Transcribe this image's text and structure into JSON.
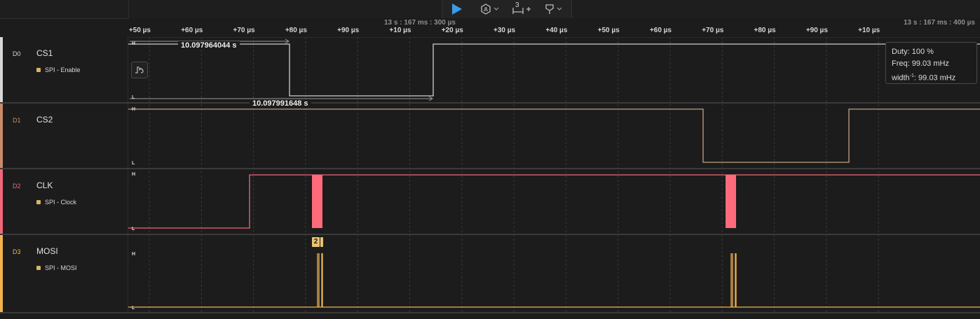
{
  "toolbar": {
    "play_icon": "play-icon",
    "trigger_icon": "trigger-icon",
    "measure_count": "3",
    "measure_icon": "measure-add-icon",
    "marker_icon": "marker-pin-icon"
  },
  "ruler": {
    "ticks_a": [
      "+50 µs",
      "+60 µs",
      "+70 µs",
      "+80 µs",
      "+90 µs",
      "+10 µs",
      "+20 µs",
      "+30 µs",
      "+40 µs",
      "+50 µs",
      "+60 µs",
      "+70 µs",
      "+80 µs",
      "+90 µs",
      "+10 µs"
    ],
    "marker_1": "13 s : 167 ms : 300 µs",
    "marker_2": "13 s : 167 ms : 400 µs"
  },
  "channels": [
    {
      "id": "D0",
      "name": "CS1",
      "analyzer": "SPI - Enable",
      "color": "#d7d7d7"
    },
    {
      "id": "D1",
      "name": "CS2",
      "analyzer": "",
      "color": "#c98a6a"
    },
    {
      "id": "D2",
      "name": "CLK",
      "analyzer": "SPI - Clock",
      "color": "#f2667a"
    },
    {
      "id": "D3",
      "name": "MOSI",
      "analyzer": "SPI - MOSI",
      "color": "#f2b34d"
    }
  ],
  "levels": {
    "high": "H",
    "low": "L"
  },
  "measurements": {
    "cs1_high": "10.097964044 s",
    "cs1_period": "10.097991648 s"
  },
  "tooltip": {
    "duty": "Duty: 100 %",
    "freq": "Freq: 99.03 mHz",
    "width_prefix": "width",
    "width_sup": "-1",
    "width_value": ": 99.03 mHz"
  },
  "mosi_badge": "2"
}
